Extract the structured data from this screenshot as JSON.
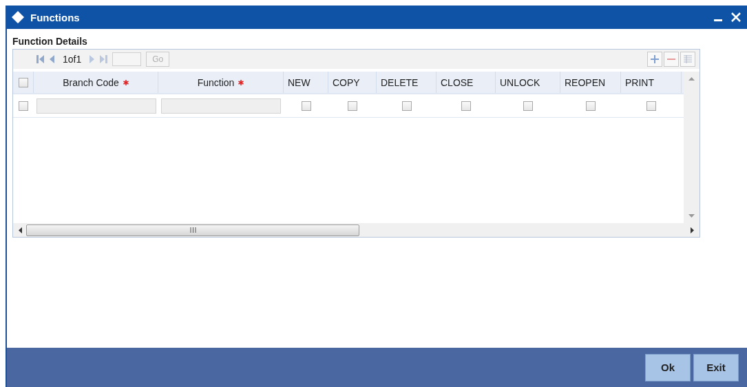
{
  "window": {
    "title": "Functions"
  },
  "section": {
    "title": "Function Details"
  },
  "pager": {
    "page_text": "1of1",
    "go_label": "Go"
  },
  "grid": {
    "select_all_checked": false,
    "columns": [
      {
        "label": "Branch Code",
        "kind": "text",
        "required": true
      },
      {
        "label": "Function",
        "kind": "text",
        "required": true
      },
      {
        "label": "NEW",
        "kind": "check",
        "required": false
      },
      {
        "label": "COPY",
        "kind": "check",
        "required": false
      },
      {
        "label": "DELETE",
        "kind": "check",
        "required": false
      },
      {
        "label": "CLOSE",
        "kind": "check",
        "required": false
      },
      {
        "label": "UNLOCK",
        "kind": "check",
        "required": false
      },
      {
        "label": "REOPEN",
        "kind": "check",
        "required": false
      },
      {
        "label": "PRINT",
        "kind": "check",
        "required": false
      }
    ],
    "rows": [
      {
        "selected": false,
        "cells": [
          {
            "kind": "text"
          },
          {
            "kind": "text"
          },
          {
            "kind": "check",
            "checked": false
          },
          {
            "kind": "check",
            "checked": false
          },
          {
            "kind": "check",
            "checked": false
          },
          {
            "kind": "check",
            "checked": false
          },
          {
            "kind": "check",
            "checked": false
          },
          {
            "kind": "check",
            "checked": false
          },
          {
            "kind": "check",
            "checked": false
          }
        ]
      }
    ]
  },
  "buttons": [
    "Ok",
    "Exit"
  ]
}
